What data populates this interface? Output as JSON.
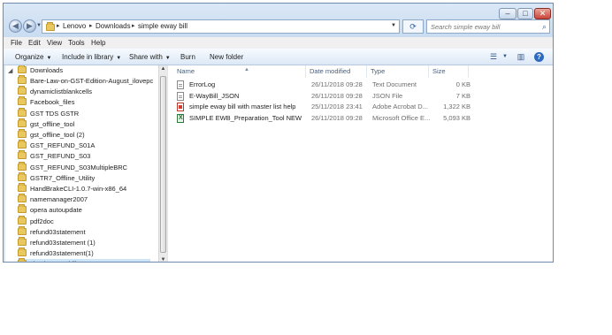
{
  "window": {
    "controls": {
      "minimize": "–",
      "maximize": "□",
      "close": "✕"
    }
  },
  "address": {
    "crumbs": [
      "Lenovo",
      "Downloads",
      "simple eway bill"
    ],
    "search_placeholder": "Search simple eway bill"
  },
  "menubar": {
    "items": [
      "File",
      "Edit",
      "View",
      "Tools",
      "Help"
    ]
  },
  "toolbar": {
    "organize": "Organize",
    "include_in_library": "Include in library",
    "share_with": "Share with",
    "burn": "Burn",
    "new_folder": "New folder"
  },
  "navpane": {
    "root": "Downloads",
    "items": [
      "Bare-Law-on-GST-Edition-August_ilovepc",
      "dynamiclistblankcells",
      "Facebook_files",
      "GST TDS GSTR",
      "gst_offline_tool",
      "gst_offline_tool (2)",
      "GST_REFUND_S01A",
      "GST_REFUND_S03",
      "GST_REFUND_S03MultipleBRC",
      "GSTR7_Offline_Utility",
      "HandBrakeCLI-1.0.7-win-x86_64",
      "namemanager2007",
      "opera autoupdate",
      "pdf2doc",
      "refund03statement",
      "refund03statement (1)",
      "refund03statement(1)",
      "simple eway bill"
    ]
  },
  "filelist": {
    "columns": {
      "name": "Name",
      "date": "Date modified",
      "type": "Type",
      "size": "Size"
    },
    "rows": [
      {
        "name": "ErrorLog",
        "date": "26/11/2018 09:28",
        "type": "Text Document",
        "size": "0 KB",
        "icon": "text-file-icon"
      },
      {
        "name": "E-WayBill_JSON",
        "date": "26/11/2018 09:28",
        "type": "JSON File",
        "size": "7 KB",
        "icon": "json-file-icon"
      },
      {
        "name": "simple eway bill with master list help",
        "date": "25/11/2018 23:41",
        "type": "Adobe Acrobat D...",
        "size": "1,322 KB",
        "icon": "pdf-file-icon"
      },
      {
        "name": "SIMPLE EWB_Preparation_Tool NEW VER...",
        "date": "26/11/2018 09:28",
        "type": "Microsoft Office E...",
        "size": "5,093 KB",
        "icon": "excel-file-icon"
      }
    ]
  },
  "colors": {
    "selection": "#cce4f7",
    "folder": "#e9c860",
    "frame": "#d9e6f4"
  }
}
